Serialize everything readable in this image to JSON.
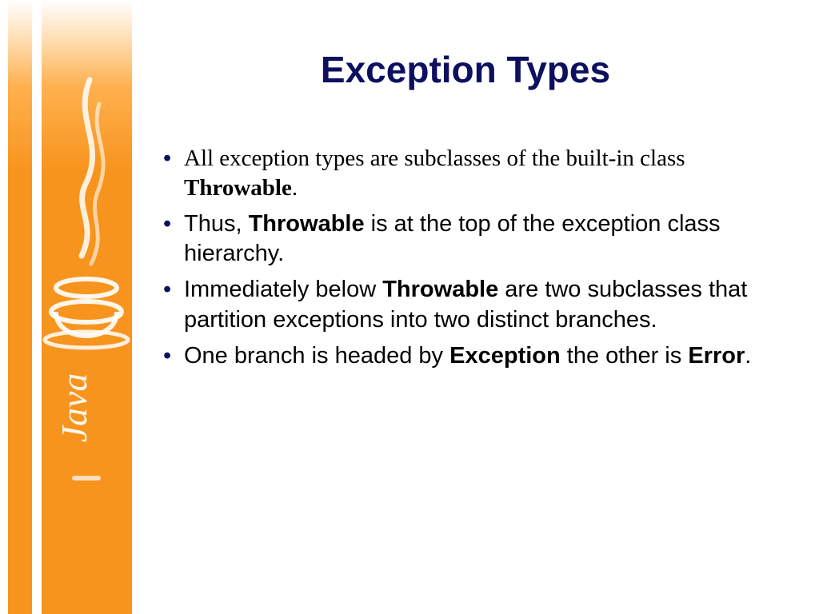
{
  "title": "Exception Types",
  "bullets": [
    {
      "pre": "All exception types are subclasses of the built-in class ",
      "bold": "Throwable",
      "post": ".",
      "serif": true
    },
    {
      "pre": "Thus, ",
      "bold": "Throwable",
      "post": " is at the top of the exception class hierarchy.",
      "serif": false
    },
    {
      "pre": "Immediately below ",
      "bold": "Throwable",
      "post": " are two subclasses that partition exceptions into two distinct branches.",
      "serif": false
    },
    {
      "pre": "One branch is headed by ",
      "bold": "Exception",
      "post2_pre": " the other is ",
      "bold2": "Error",
      "post2": ".",
      "serif": false
    }
  ],
  "sidebar_logo_label": "Java"
}
